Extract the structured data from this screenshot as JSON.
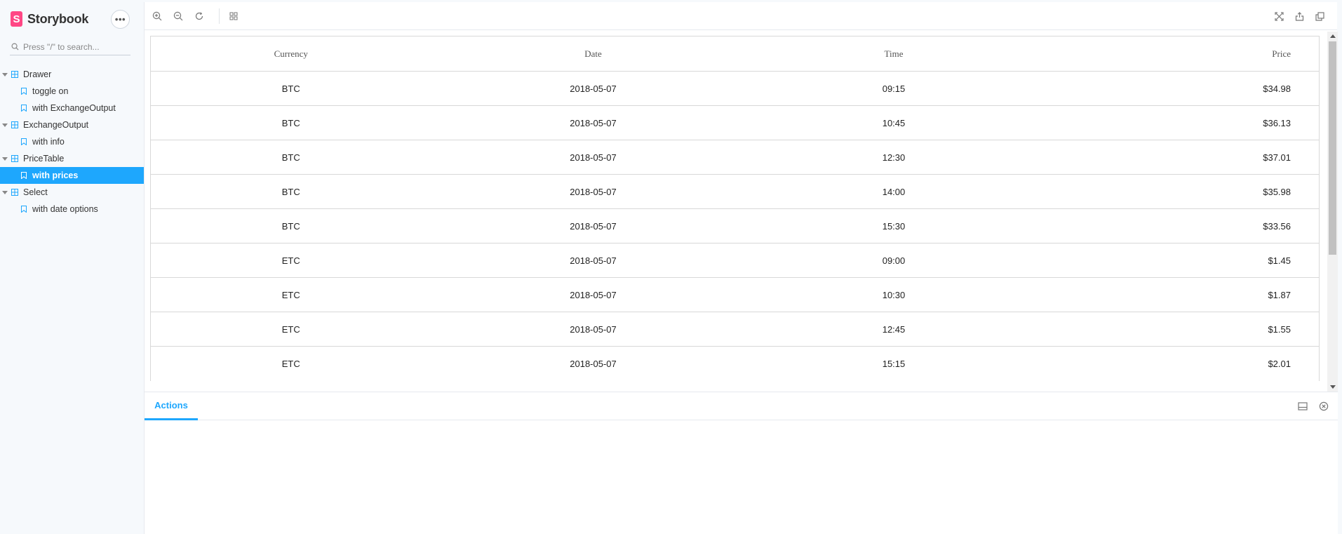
{
  "app": {
    "name": "Storybook",
    "logo_letter": "S",
    "menu_label": "•••",
    "accent_color": "#1ea7fd",
    "brand_color": "#ff4785"
  },
  "search": {
    "placeholder": "Press \"/\" to search..."
  },
  "sidebar": {
    "groups": [
      {
        "label": "Drawer",
        "stories": [
          "toggle on",
          "with ExchangeOutput"
        ]
      },
      {
        "label": "ExchangeOutput",
        "stories": [
          "with info"
        ]
      },
      {
        "label": "PriceTable",
        "stories": [
          "with prices"
        ]
      },
      {
        "label": "Select",
        "stories": [
          "with date options"
        ]
      }
    ],
    "selected_story": "with prices"
  },
  "toolbar": {
    "left_icons": [
      "zoom-in-icon",
      "zoom-out-icon",
      "zoom-reset-icon",
      "grid-icon"
    ],
    "right_icons": [
      "fullscreen-icon",
      "share-icon",
      "copy-icon"
    ]
  },
  "table": {
    "headers": [
      "Currency",
      "Date",
      "Time",
      "Price"
    ],
    "rows": [
      [
        "BTC",
        "2018-05-07",
        "09:15",
        "$34.98"
      ],
      [
        "BTC",
        "2018-05-07",
        "10:45",
        "$36.13"
      ],
      [
        "BTC",
        "2018-05-07",
        "12:30",
        "$37.01"
      ],
      [
        "BTC",
        "2018-05-07",
        "14:00",
        "$35.98"
      ],
      [
        "BTC",
        "2018-05-07",
        "15:30",
        "$33.56"
      ],
      [
        "ETC",
        "2018-05-07",
        "09:00",
        "$1.45"
      ],
      [
        "ETC",
        "2018-05-07",
        "10:30",
        "$1.87"
      ],
      [
        "ETC",
        "2018-05-07",
        "12:45",
        "$1.55"
      ],
      [
        "ETC",
        "2018-05-07",
        "15:15",
        "$2.01"
      ]
    ]
  },
  "addons": {
    "tabs": [
      "Actions"
    ],
    "active_tab": "Actions",
    "icons": [
      "panel-layout-icon",
      "close-circle-icon"
    ]
  }
}
